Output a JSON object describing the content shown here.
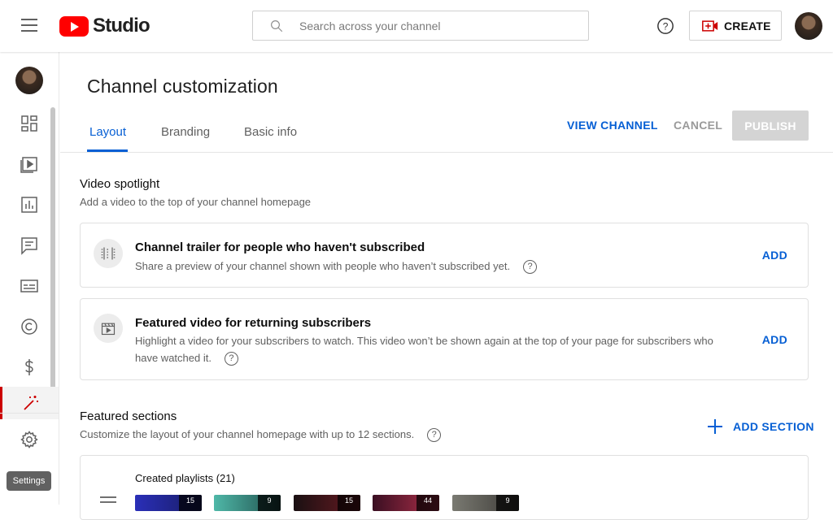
{
  "header": {
    "logo_text": "Studio",
    "search_placeholder": "Search across your channel",
    "create_label": "CREATE",
    "help_glyph": "?"
  },
  "sidebar": {
    "items": [
      "Dashboard",
      "Content",
      "Analytics",
      "Comments",
      "Subtitles",
      "Copyright",
      "Earn",
      "Customization"
    ],
    "active": "Customization",
    "settings_tooltip": "Settings"
  },
  "page": {
    "title": "Channel customization",
    "tabs": [
      "Layout",
      "Branding",
      "Basic info"
    ],
    "active_tab": "Layout",
    "view_channel": "VIEW CHANNEL",
    "cancel": "CANCEL",
    "publish": "PUBLISH"
  },
  "spotlight": {
    "title": "Video spotlight",
    "subtitle": "Add a video to the top of your channel homepage",
    "cards": [
      {
        "title": "Channel trailer for people who haven't subscribed",
        "desc": "Share a preview of your channel shown with people who haven’t subscribed yet.",
        "action": "ADD"
      },
      {
        "title": "Featured video for returning subscribers",
        "desc_line1": "Highlight a video for your subscribers to watch. This video won’t be shown again at the top of your page for subscribers who",
        "desc_line2": "have watched it.",
        "action": "ADD"
      }
    ]
  },
  "featured": {
    "title": "Featured sections",
    "subtitle": "Customize the layout of your channel homepage with up to 12 sections.",
    "add_section": "ADD SECTION",
    "playlist_title": "Created playlists (21)",
    "thumb_counts": [
      "15",
      "9",
      "15",
      "44",
      "9"
    ]
  },
  "colors": {
    "accent": "#065fd4",
    "brand_red": "#ff0000",
    "active_sidebar": "#cc0000"
  }
}
